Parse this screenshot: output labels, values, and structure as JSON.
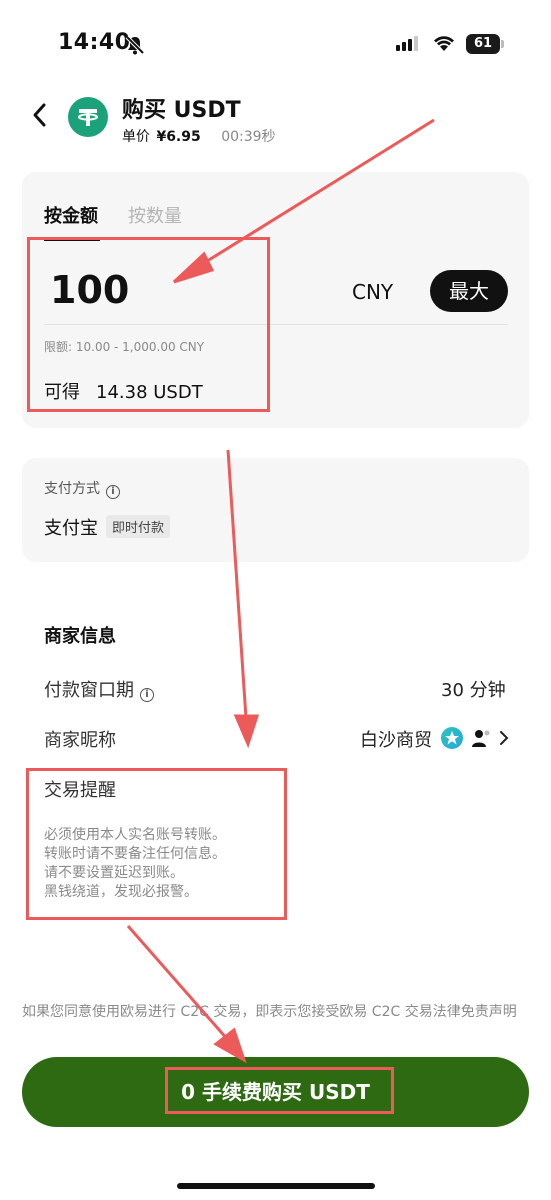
{
  "status_bar": {
    "time": "14:40",
    "battery": "61"
  },
  "header": {
    "title": "购买 USDT",
    "price_label": "单价",
    "price": "¥6.95",
    "countdown": "00:39秒"
  },
  "amount_card": {
    "tabs": [
      "按金额",
      "按数量"
    ],
    "amount": "100",
    "currency": "CNY",
    "max_label": "最大",
    "limit": "限额: 10.00 - 1,000.00 CNY",
    "receive_label": "可得",
    "receive_value": "14.38 USDT"
  },
  "payment": {
    "label": "支付方式",
    "method": "支付宝",
    "tag": "即时付款"
  },
  "merchant": {
    "title": "商家信息",
    "window_label": "付款窗口期",
    "window_value": "30 分钟",
    "nickname_label": "商家昵称",
    "nickname_value": "白沙商贸"
  },
  "tips": {
    "title": "交易提醒",
    "lines": [
      "必须使用本人实名账号转账。",
      "转账时请不要备注任何信息。",
      "请不要设置延迟到账。",
      "黑钱绕道，发现必报警。"
    ]
  },
  "disclaimer": "如果您同意使用欧易进行 C2C 交易，即表示您接受欧易 C2C 交易法律免责声明",
  "buy_button": "0 手续费购买 USDT",
  "colors": {
    "brand_green": "#2e6a12",
    "coin_green": "#1ba27a",
    "annotation_red": "#ec5a5a"
  }
}
